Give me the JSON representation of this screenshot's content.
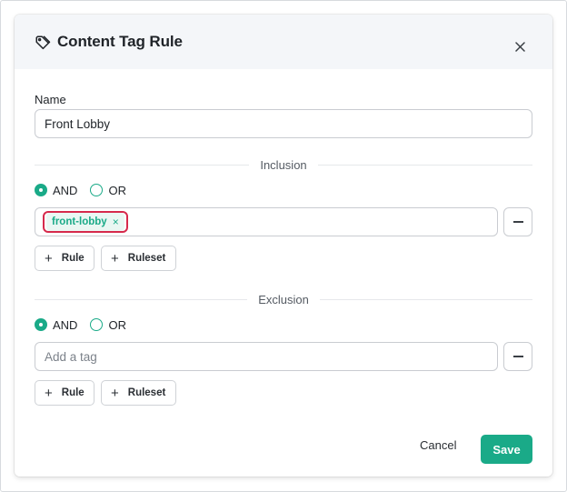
{
  "dialog": {
    "title": "Content Tag Rule",
    "title_icon": "tag-icon",
    "close_icon": "close-icon"
  },
  "name_field": {
    "label": "Name",
    "value": "Front Lobby"
  },
  "inclusion": {
    "heading": "Inclusion",
    "and_label": "AND",
    "or_label": "OR",
    "selected": "AND",
    "tags": [
      {
        "label": "front-lobby",
        "remove_icon": "×"
      }
    ],
    "rule_button": "Rule",
    "ruleset_button": "Ruleset"
  },
  "exclusion": {
    "heading": "Exclusion",
    "and_label": "AND",
    "or_label": "OR",
    "selected": "AND",
    "placeholder": "Add a tag",
    "rule_button": "Rule",
    "ruleset_button": "Ruleset"
  },
  "footer": {
    "cancel_label": "Cancel",
    "save_label": "Save"
  },
  "colors": {
    "accent": "#1aaa88",
    "highlight": "#d62a4c",
    "header_bg": "#f4f6f9"
  }
}
